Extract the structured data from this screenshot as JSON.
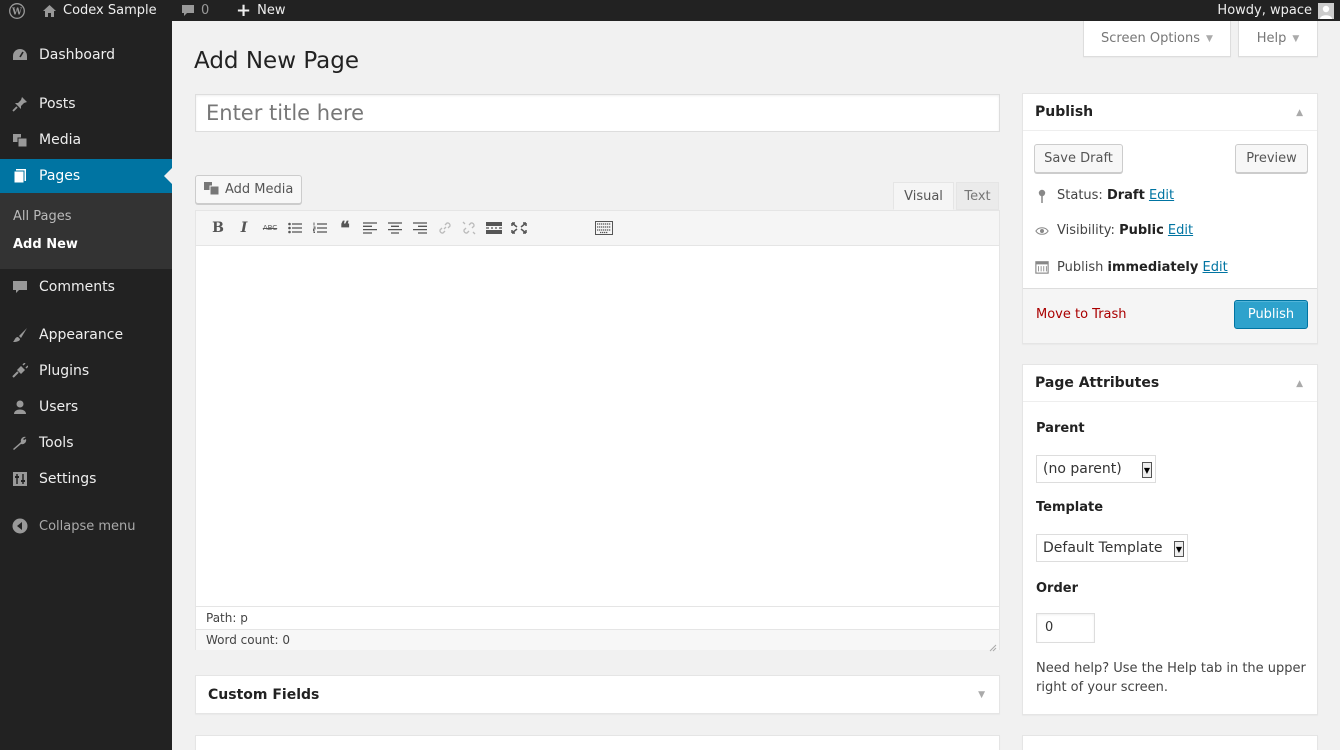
{
  "adminbar": {
    "site_name": "Codex Sample",
    "comments_count": "0",
    "new_label": "New",
    "greeting": "Howdy, wpace"
  },
  "sidebar": {
    "items": [
      {
        "label": "Dashboard",
        "icon": "dashboard-icon"
      },
      {
        "label": "Posts",
        "icon": "pin-icon"
      },
      {
        "label": "Media",
        "icon": "media-icon"
      },
      {
        "label": "Pages",
        "icon": "pages-icon",
        "active": true
      },
      {
        "label": "Comments",
        "icon": "comment-icon"
      },
      {
        "label": "Appearance",
        "icon": "brush-icon"
      },
      {
        "label": "Plugins",
        "icon": "plug-icon"
      },
      {
        "label": "Users",
        "icon": "user-icon"
      },
      {
        "label": "Tools",
        "icon": "wrench-icon"
      },
      {
        "label": "Settings",
        "icon": "settings-icon"
      }
    ],
    "submenu": [
      "All Pages",
      "Add New"
    ],
    "collapse_label": "Collapse menu"
  },
  "screen_meta": {
    "screen_options": "Screen Options",
    "help": "Help"
  },
  "main": {
    "page_title": "Add New Page",
    "title_placeholder": "Enter title here",
    "add_media_label": "Add Media",
    "tab_visual": "Visual",
    "tab_text": "Text",
    "path_label": "Path: p",
    "word_count": "Word count: 0"
  },
  "custom_fields": {
    "title": "Custom Fields"
  },
  "publish": {
    "title": "Publish",
    "save_draft": "Save Draft",
    "preview": "Preview",
    "status_label": "Status:",
    "status_value": "Draft",
    "visibility_label": "Visibility:",
    "visibility_value": "Public",
    "schedule_label": "Publish",
    "schedule_value": "immediately",
    "edit": "Edit",
    "trash": "Move to Trash",
    "publish_button": "Publish"
  },
  "page_attributes": {
    "title": "Page Attributes",
    "parent_label": "Parent",
    "parent_value": "(no parent)",
    "template_label": "Template",
    "template_value": "Default Template",
    "order_label": "Order",
    "order_value": "0",
    "help_text": "Need help? Use the Help tab in the upper right of your screen."
  },
  "colors": {
    "accent": "#0074a2",
    "primary_button": "#2ea2cc",
    "trash": "#a00000",
    "sidebar": "#222222"
  }
}
